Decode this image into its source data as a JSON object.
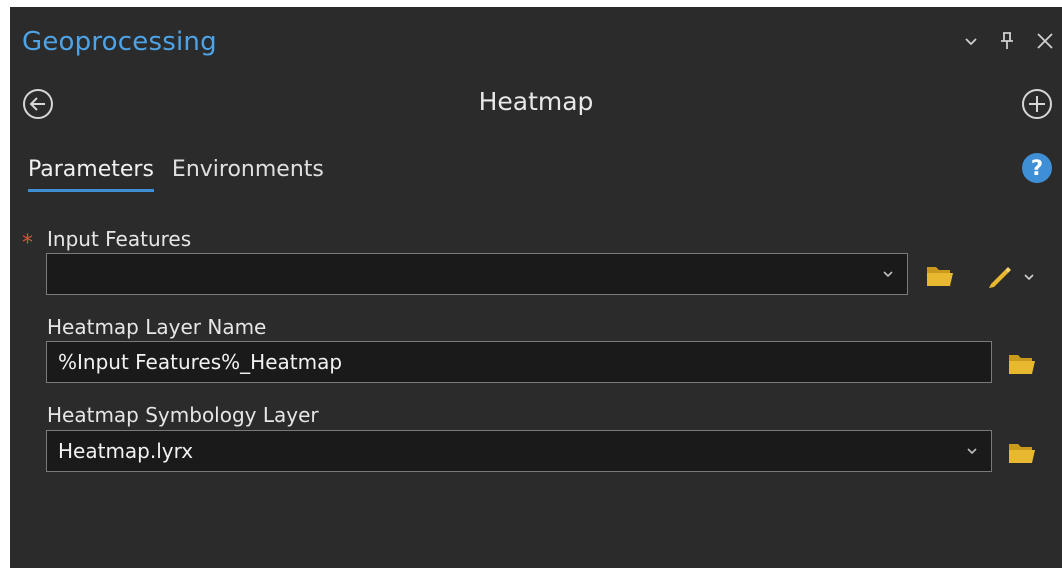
{
  "pane": {
    "title": "Geoprocessing",
    "tool_title": "Heatmap",
    "title_icons": [
      "chevron-down-icon",
      "pin-icon",
      "close-icon"
    ]
  },
  "tabs": [
    {
      "label": "Parameters",
      "active": true
    },
    {
      "label": "Environments",
      "active": false
    }
  ],
  "help": {
    "glyph": "?"
  },
  "parameters": {
    "input_features": {
      "label": "Input Features",
      "required_marker": "*",
      "value": ""
    },
    "layer_name": {
      "label": "Heatmap Layer Name",
      "value": "%Input Features%_Heatmap"
    },
    "symbology_layer": {
      "label": "Heatmap Symbology Layer",
      "value": "Heatmap.lyrx"
    }
  },
  "colors": {
    "background": "#2b2b2b",
    "accent": "#3f8fd6",
    "title": "#4da3e6",
    "required": "#d9553a",
    "folder": "#e8b830"
  }
}
